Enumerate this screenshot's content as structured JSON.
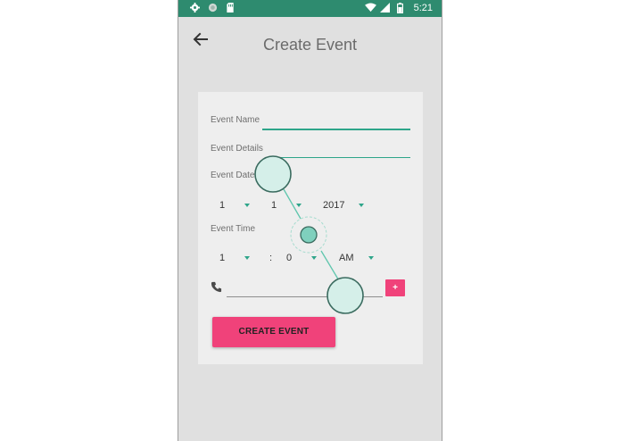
{
  "status_bar": {
    "left_icons": [
      "settings-icon",
      "sync-icon",
      "sd-card-icon"
    ],
    "right_icons": [
      "wifi-icon",
      "signal-icon",
      "battery-icon"
    ],
    "time": "5:21",
    "background": "#2e8b6f"
  },
  "app_bar": {
    "back_icon": "arrow-back-icon",
    "title": "Create Event"
  },
  "form": {
    "event_name_label": "Event Name",
    "event_details_label": "Event Details",
    "event_date_label": "Event Date",
    "date": {
      "day": "1",
      "month": "1",
      "year": "2017"
    },
    "event_time_label": "Event Time",
    "time": {
      "hour": "1",
      "separator": ":",
      "minute": "0",
      "ampm": "AM"
    },
    "phone_icon": "phone-icon",
    "add_button_label": "+",
    "create_button_label": "CREATE EVENT"
  },
  "colors": {
    "accent": "#2ea58a",
    "button": "#f0427a",
    "tutorial_overlay": "#bfe8df"
  }
}
